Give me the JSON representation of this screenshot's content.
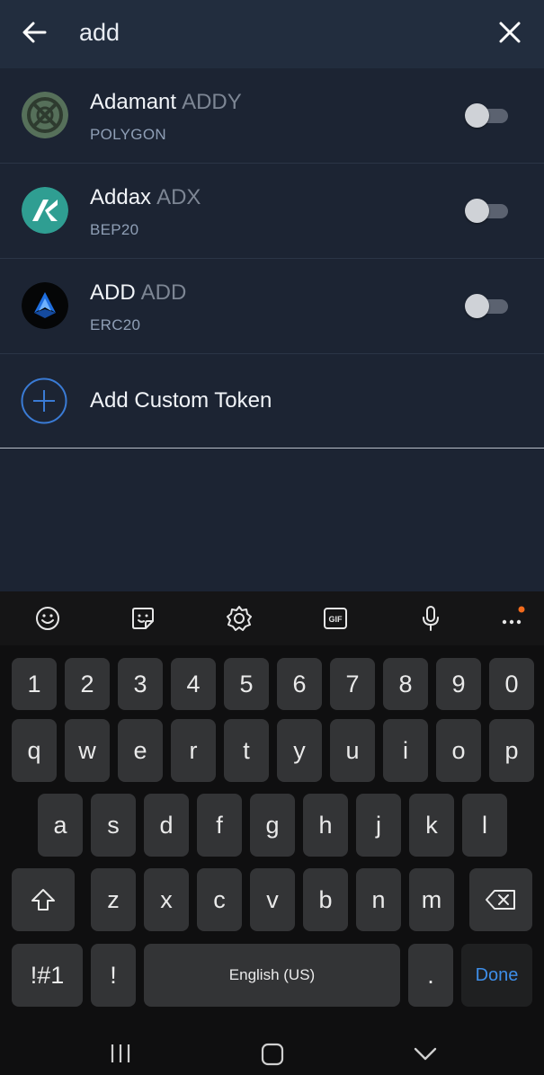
{
  "header": {
    "search_value": "add",
    "back_icon": "arrow-left-icon",
    "close_icon": "close-icon"
  },
  "tokens": [
    {
      "name": "Adamant",
      "symbol": "ADDY",
      "network": "POLYGON",
      "enabled": false,
      "logo_icon": "adamant-logo-icon",
      "color": "#5b7a5a"
    },
    {
      "name": "Addax",
      "symbol": "ADX",
      "network": "BEP20",
      "enabled": false,
      "logo_icon": "addax-logo-icon",
      "color": "#2a9d8f"
    },
    {
      "name": "ADD",
      "symbol": "ADD",
      "network": "ERC20",
      "enabled": false,
      "logo_icon": "add-logo-icon",
      "color": "#1f6fe0"
    }
  ],
  "custom_token": {
    "label": "Add Custom Token",
    "icon": "plus-circle-icon",
    "color": "#3a7bd5"
  },
  "keyboard": {
    "toolbar": [
      "emoji-icon",
      "sticker-icon",
      "settings-icon",
      "gif-icon",
      "microphone-icon",
      "more-icon"
    ],
    "row_numbers": [
      "1",
      "2",
      "3",
      "4",
      "5",
      "6",
      "7",
      "8",
      "9",
      "0"
    ],
    "row_top": [
      "q",
      "w",
      "e",
      "r",
      "t",
      "y",
      "u",
      "i",
      "o",
      "p"
    ],
    "row_middle": [
      "a",
      "s",
      "d",
      "f",
      "g",
      "h",
      "j",
      "k",
      "l"
    ],
    "row_bottom": [
      "z",
      "x",
      "c",
      "v",
      "b",
      "n",
      "m"
    ],
    "symbols_label": "!#1",
    "exclaim_label": "!",
    "space_label": "English (US)",
    "period_label": ".",
    "done_label": "Done",
    "shift_icon": "shift-icon",
    "backspace_icon": "backspace-icon",
    "accent_color": "#3e8ee8",
    "notification_color": "#f26b1d"
  },
  "navbar": [
    "recent-apps-icon",
    "home-icon",
    "back-chevron-icon"
  ]
}
